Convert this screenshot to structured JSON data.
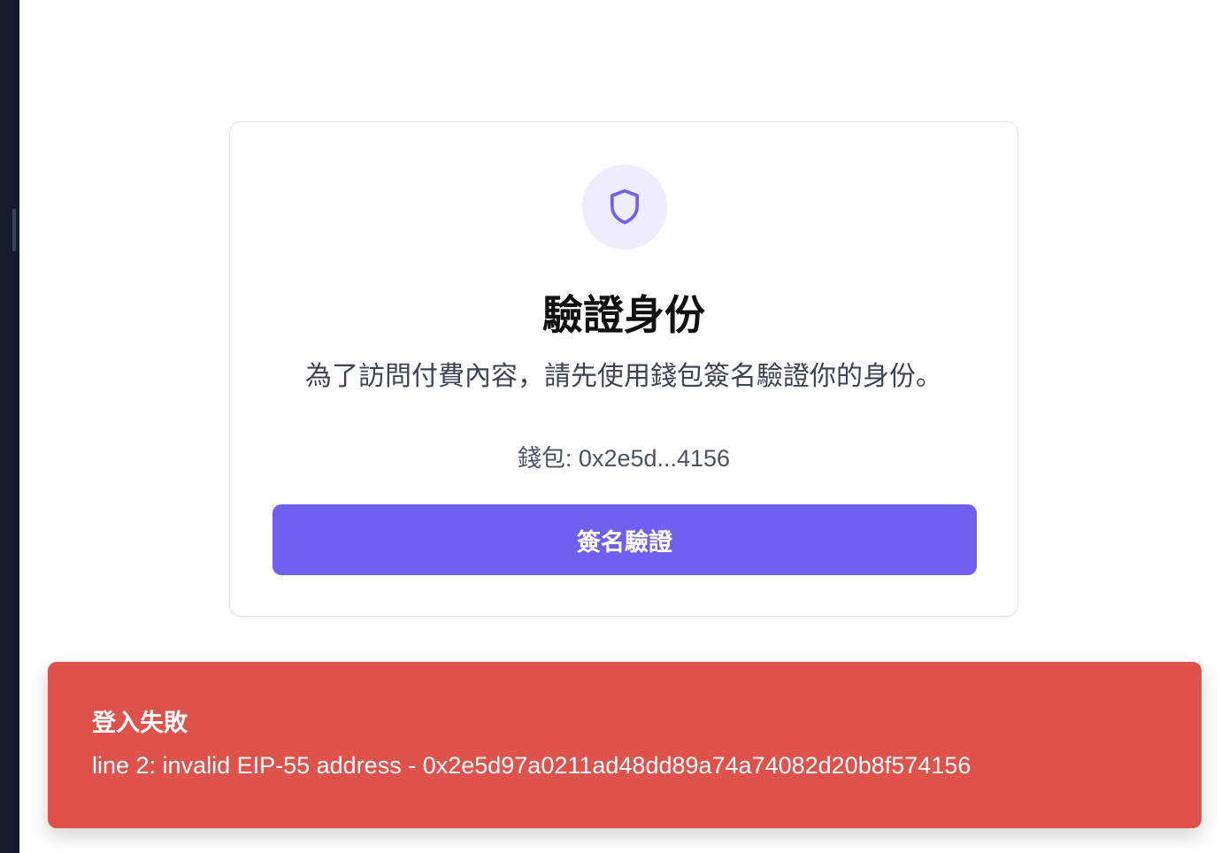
{
  "auth_card": {
    "icon": "shield-icon",
    "title": "驗證身份",
    "subtitle": "為了訪問付費內容，請先使用錢包簽名驗證你的身份。",
    "wallet_label": "錢包: 0x2e5d...4156",
    "sign_button_label": "簽名驗證"
  },
  "toast": {
    "title": "登入失敗",
    "message": "line 2: invalid EIP-55 address - 0x2e5d97a0211ad48dd89a74a74082d20b8f574156"
  },
  "colors": {
    "accent": "#6f60f0",
    "accent_soft": "#eeecfd",
    "error": "#dd524b",
    "sidebar": "#141b2b"
  }
}
